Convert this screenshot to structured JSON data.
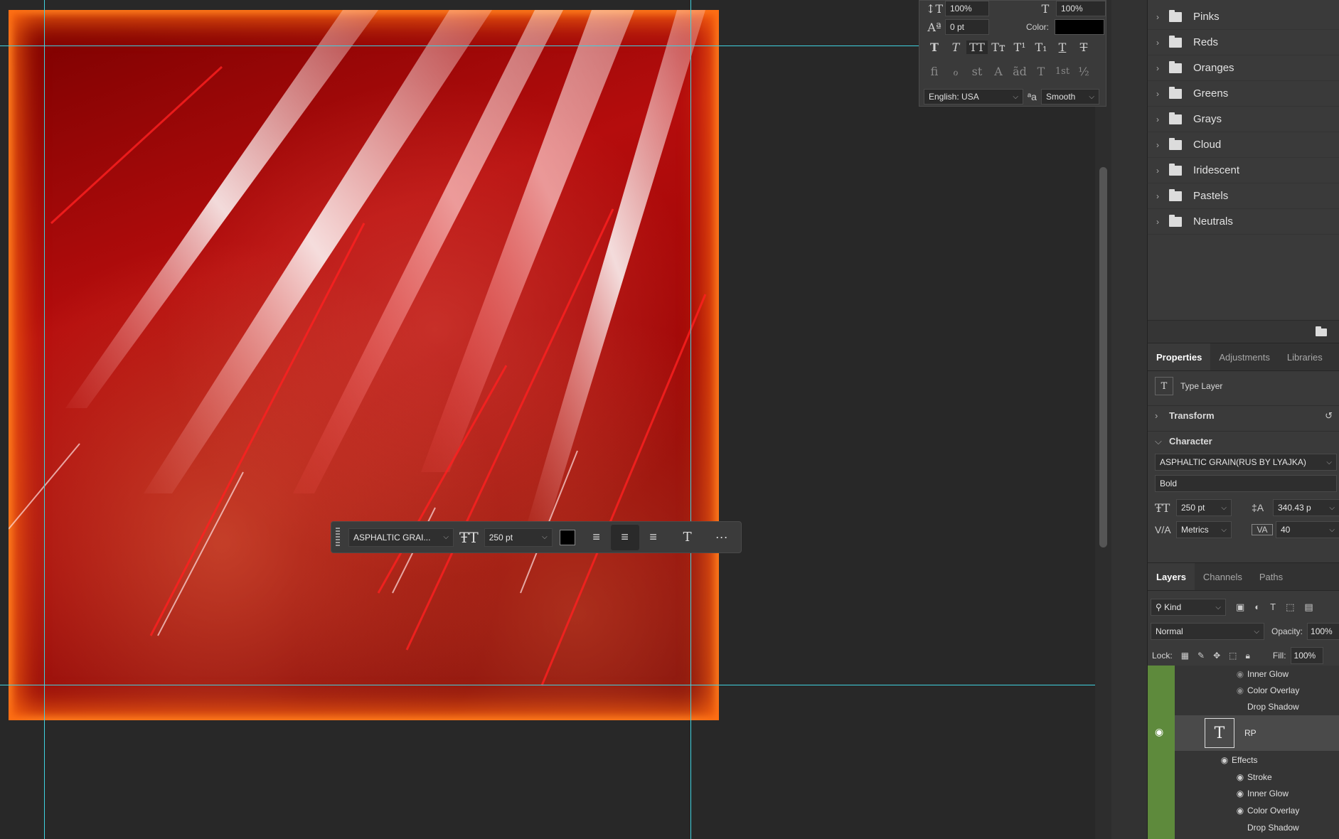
{
  "character_panel": {
    "vertical_scale": "100%",
    "horizontal_scale": "100%",
    "baseline_shift": "0 pt",
    "color_label": "Color:",
    "color_value": "#000000",
    "language": "English: USA",
    "antialias": "Smooth",
    "aa_glyph": "ªa",
    "style_glyphs": [
      "T",
      "T",
      "TT",
      "Tт",
      "T¹",
      "T₁",
      "T",
      "T"
    ],
    "opentype_glyphs": [
      "ﬁ",
      "ℴ",
      "st",
      "A",
      "ãd",
      "T",
      "1st",
      "½"
    ]
  },
  "task_bar": {
    "font": "ASPHALTIC GRAI...",
    "size": "250 pt",
    "color": "#000000",
    "more": "···"
  },
  "swatches": {
    "folders": [
      "Pinks",
      "Reds",
      "Oranges",
      "Greens",
      "Grays",
      "Cloud",
      "Iridescent",
      "Pastels",
      "Neutrals"
    ]
  },
  "properties": {
    "tabs": [
      "Properties",
      "Adjustments",
      "Libraries"
    ],
    "layer_type": "Type Layer",
    "transform_label": "Transform",
    "character_label": "Character",
    "font_family": "ASPHALTIC GRAIN(RUS BY LYAJKA)",
    "font_style": "Bold",
    "size": "250 pt",
    "leading": "340.43 p",
    "kerning": "Metrics",
    "tracking": "40"
  },
  "layers": {
    "tabs": [
      "Layers",
      "Channels",
      "Paths"
    ],
    "filter_kind": "Kind",
    "blend_mode": "Normal",
    "opacity_label": "Opacity:",
    "opacity": "100%",
    "lock_label": "Lock:",
    "fill_label": "Fill:",
    "fill": "100%",
    "prev_effects": [
      "Inner Glow",
      "Color Overlay",
      "Drop Shadow"
    ],
    "layer_name": "RP",
    "effects_label": "Effects",
    "effects": [
      "Stroke",
      "Inner Glow",
      "Color Overlay",
      "Drop Shadow"
    ]
  }
}
